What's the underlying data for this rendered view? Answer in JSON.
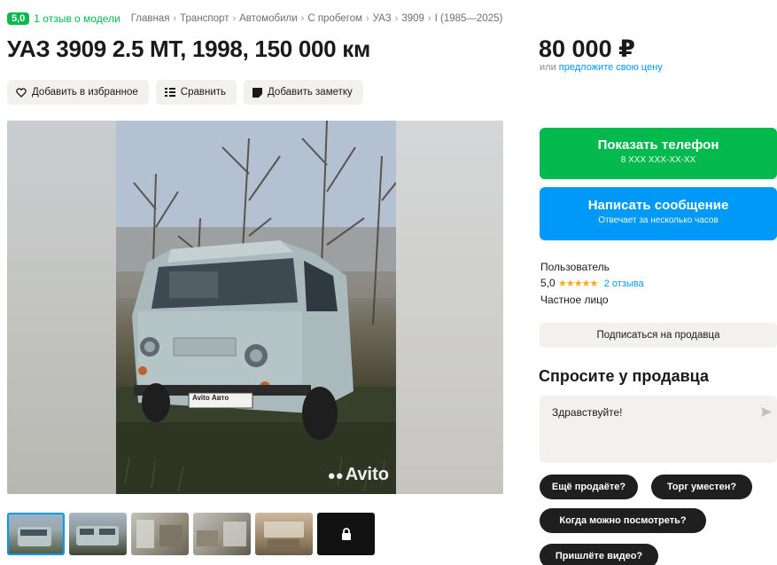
{
  "breadcrumbs": {
    "rating": "5,0",
    "reviews_link": "1 отзыв о модели",
    "items": [
      "Главная",
      "Транспорт",
      "Автомобили",
      "С пробегом",
      "УАЗ",
      "3909",
      "I (1985—2025)"
    ],
    "separator": "›"
  },
  "listing": {
    "title": "УАЗ 3909 2.5 MT, 1998, 150 000 км",
    "price": "80 000 ₽",
    "price_or": "или",
    "price_offer_link": "предложите свою цену"
  },
  "actions": {
    "favorite": "Добавить в избранное",
    "compare": "Сравнить",
    "note": "Добавить заметку"
  },
  "gallery": {
    "badge": "Avito Авто",
    "watermark": "Avito",
    "thumb_count_visible": 6
  },
  "contact": {
    "phone_label": "Показать телефон",
    "phone_masked": "8 XXX XXX-XX-XX",
    "message_label": "Написать сообщение",
    "message_sub": "Отвечает за несколько часов"
  },
  "seller": {
    "name": "Пользователь",
    "rating": "5,0",
    "stars": "★★★★★",
    "reviews": "2 отзыва",
    "type": "Частное лицо",
    "subscribe": "Подписаться на продавца"
  },
  "ask": {
    "title": "Спросите у продавца",
    "message": "Здравствуйте!",
    "chips": [
      "Ещё продаёте?",
      "Торг уместен?",
      "Когда можно посмотреть?",
      "Пришлёте видео?"
    ]
  },
  "colors": {
    "green": "#04b94e",
    "blue": "#0099f7",
    "gray_bg": "#f2f1f0",
    "chip_bg": "#1f1f1f"
  }
}
